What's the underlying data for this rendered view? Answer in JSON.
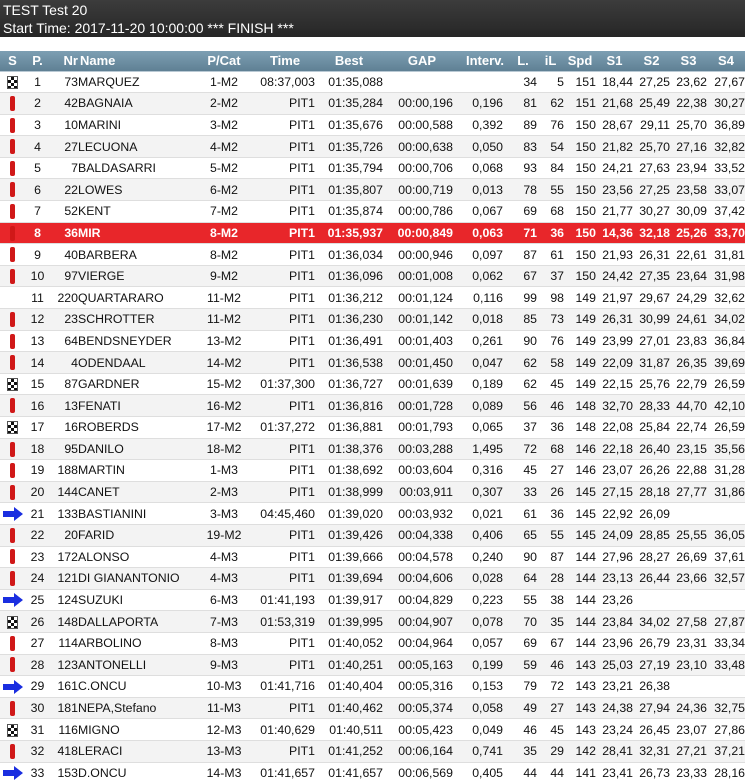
{
  "header": {
    "title": "TEST Test 20",
    "subtitle": "Start Time: 2017-11-20 10:00:00 *** FINISH ***"
  },
  "columns": [
    "S",
    "P.",
    "Nr",
    "Name",
    "P/Cat",
    "Time",
    "Best",
    "GAP",
    "Interv.",
    "L.",
    "iL",
    "Spd",
    "S1",
    "S2",
    "S3",
    "S4"
  ],
  "colors": {
    "title_bg": "#2f2f2f",
    "header_bg": "#6d8fa3",
    "highlight_row": "#e8262a",
    "pit_marker": "#d01818",
    "arrow": "#1a2ee0"
  },
  "rows": [
    {
      "s": "flag-icon",
      "p": "1",
      "nr": "73",
      "name": "MARQUEZ",
      "cat": "1-M2",
      "time": "08:37,003",
      "best": "01:35,088",
      "gap": "",
      "interv": "",
      "l": "34",
      "il": "5",
      "spd": "151",
      "s1": "18,44",
      "s2": "27,25",
      "s3": "23,62",
      "s4": "27,67"
    },
    {
      "s": "pit-icon",
      "p": "2",
      "nr": "42",
      "name": "BAGNAIA",
      "cat": "2-M2",
      "time": "PIT1",
      "best": "01:35,284",
      "gap": "00:00,196",
      "interv": "0,196",
      "l": "81",
      "il": "62",
      "spd": "151",
      "s1": "21,68",
      "s2": "25,49",
      "s3": "22,38",
      "s4": "30,27"
    },
    {
      "s": "pit-icon",
      "p": "3",
      "nr": "10",
      "name": "MARINI",
      "cat": "3-M2",
      "time": "PIT1",
      "best": "01:35,676",
      "gap": "00:00,588",
      "interv": "0,392",
      "l": "89",
      "il": "76",
      "spd": "150",
      "s1": "28,67",
      "s2": "29,11",
      "s3": "25,70",
      "s4": "36,89"
    },
    {
      "s": "pit-icon",
      "p": "4",
      "nr": "27",
      "name": "LECUONA",
      "cat": "4-M2",
      "time": "PIT1",
      "best": "01:35,726",
      "gap": "00:00,638",
      "interv": "0,050",
      "l": "83",
      "il": "54",
      "spd": "150",
      "s1": "21,82",
      "s2": "25,70",
      "s3": "27,16",
      "s4": "32,82"
    },
    {
      "s": "pit-icon",
      "p": "5",
      "nr": "7",
      "name": "BALDASARRI",
      "cat": "5-M2",
      "time": "PIT1",
      "best": "01:35,794",
      "gap": "00:00,706",
      "interv": "0,068",
      "l": "93",
      "il": "84",
      "spd": "150",
      "s1": "24,21",
      "s2": "27,63",
      "s3": "23,94",
      "s4": "33,52"
    },
    {
      "s": "pit-icon",
      "p": "6",
      "nr": "22",
      "name": "LOWES",
      "cat": "6-M2",
      "time": "PIT1",
      "best": "01:35,807",
      "gap": "00:00,719",
      "interv": "0,013",
      "l": "78",
      "il": "55",
      "spd": "150",
      "s1": "23,56",
      "s2": "27,25",
      "s3": "23,58",
      "s4": "33,07"
    },
    {
      "s": "pit-icon",
      "p": "7",
      "nr": "52",
      "name": "KENT",
      "cat": "7-M2",
      "time": "PIT1",
      "best": "01:35,874",
      "gap": "00:00,786",
      "interv": "0,067",
      "l": "69",
      "il": "68",
      "spd": "150",
      "s1": "21,77",
      "s2": "30,27",
      "s3": "30,09",
      "s4": "37,42"
    },
    {
      "s": "pit-icon",
      "p": "8",
      "nr": "36",
      "name": "MIR",
      "cat": "8-M2",
      "time": "PIT1",
      "best": "01:35,937",
      "gap": "00:00,849",
      "interv": "0,063",
      "l": "71",
      "il": "36",
      "spd": "150",
      "s1": "14,36",
      "s2": "32,18",
      "s3": "25,26",
      "s4": "33,70",
      "hl": true
    },
    {
      "s": "pit-icon",
      "p": "9",
      "nr": "40",
      "name": "BARBERA",
      "cat": "8-M2",
      "time": "PIT1",
      "best": "01:36,034",
      "gap": "00:00,946",
      "interv": "0,097",
      "l": "87",
      "il": "61",
      "spd": "150",
      "s1": "21,93",
      "s2": "26,31",
      "s3": "22,61",
      "s4": "31,81"
    },
    {
      "s": "pit-icon",
      "p": "10",
      "nr": "97",
      "name": "VIERGE",
      "cat": "9-M2",
      "time": "PIT1",
      "best": "01:36,096",
      "gap": "00:01,008",
      "interv": "0,062",
      "l": "67",
      "il": "37",
      "spd": "150",
      "s1": "24,42",
      "s2": "27,35",
      "s3": "23,64",
      "s4": "31,98"
    },
    {
      "s": "",
      "p": "11",
      "nr": "220",
      "name": "QUARTARARO",
      "cat": "11-M2",
      "time": "PIT1",
      "best": "01:36,212",
      "gap": "00:01,124",
      "interv": "0,116",
      "l": "99",
      "il": "98",
      "spd": "149",
      "s1": "21,97",
      "s2": "29,67",
      "s3": "24,29",
      "s4": "32,62"
    },
    {
      "s": "pit-icon",
      "p": "12",
      "nr": "23",
      "name": "SCHROTTER",
      "cat": "11-M2",
      "time": "PIT1",
      "best": "01:36,230",
      "gap": "00:01,142",
      "interv": "0,018",
      "l": "85",
      "il": "73",
      "spd": "149",
      "s1": "26,31",
      "s2": "30,99",
      "s3": "24,61",
      "s4": "34,02"
    },
    {
      "s": "pit-icon",
      "p": "13",
      "nr": "64",
      "name": "BENDSNEYDER",
      "cat": "13-M2",
      "time": "PIT1",
      "best": "01:36,491",
      "gap": "00:01,403",
      "interv": "0,261",
      "l": "90",
      "il": "76",
      "spd": "149",
      "s1": "23,99",
      "s2": "27,01",
      "s3": "23,83",
      "s4": "36,84"
    },
    {
      "s": "pit-icon",
      "p": "14",
      "nr": "4",
      "name": "ODENDAAL",
      "cat": "14-M2",
      "time": "PIT1",
      "best": "01:36,538",
      "gap": "00:01,450",
      "interv": "0,047",
      "l": "62",
      "il": "58",
      "spd": "149",
      "s1": "22,09",
      "s2": "31,87",
      "s3": "26,35",
      "s4": "39,69"
    },
    {
      "s": "flag-icon",
      "p": "15",
      "nr": "87",
      "name": "GARDNER",
      "cat": "15-M2",
      "time": "01:37,300",
      "best": "01:36,727",
      "gap": "00:01,639",
      "interv": "0,189",
      "l": "62",
      "il": "45",
      "spd": "149",
      "s1": "22,15",
      "s2": "25,76",
      "s3": "22,79",
      "s4": "26,59"
    },
    {
      "s": "pit-icon",
      "p": "16",
      "nr": "13",
      "name": "FENATI",
      "cat": "16-M2",
      "time": "PIT1",
      "best": "01:36,816",
      "gap": "00:01,728",
      "interv": "0,089",
      "l": "56",
      "il": "46",
      "spd": "148",
      "s1": "32,70",
      "s2": "28,33",
      "s3": "44,70",
      "s4": "42,10"
    },
    {
      "s": "flag-icon",
      "p": "17",
      "nr": "16",
      "name": "ROBERDS",
      "cat": "17-M2",
      "time": "01:37,272",
      "best": "01:36,881",
      "gap": "00:01,793",
      "interv": "0,065",
      "l": "37",
      "il": "36",
      "spd": "148",
      "s1": "22,08",
      "s2": "25,84",
      "s3": "22,74",
      "s4": "26,59"
    },
    {
      "s": "pit-icon",
      "p": "18",
      "nr": "95",
      "name": "DANILO",
      "cat": "18-M2",
      "time": "PIT1",
      "best": "01:38,376",
      "gap": "00:03,288",
      "interv": "1,495",
      "l": "72",
      "il": "68",
      "spd": "146",
      "s1": "22,18",
      "s2": "26,40",
      "s3": "23,15",
      "s4": "35,56"
    },
    {
      "s": "pit-icon",
      "p": "19",
      "nr": "188",
      "name": "MARTIN",
      "cat": "1-M3",
      "time": "PIT1",
      "best": "01:38,692",
      "gap": "00:03,604",
      "interv": "0,316",
      "l": "45",
      "il": "27",
      "spd": "146",
      "s1": "23,07",
      "s2": "26,26",
      "s3": "22,88",
      "s4": "31,28"
    },
    {
      "s": "pit-icon",
      "p": "20",
      "nr": "144",
      "name": "CANET",
      "cat": "2-M3",
      "time": "PIT1",
      "best": "01:38,999",
      "gap": "00:03,911",
      "interv": "0,307",
      "l": "33",
      "il": "26",
      "spd": "145",
      "s1": "27,15",
      "s2": "28,18",
      "s3": "27,77",
      "s4": "31,86"
    },
    {
      "s": "arrow-icon",
      "p": "21",
      "nr": "133",
      "name": "BASTIANINI",
      "cat": "3-M3",
      "time": "04:45,460",
      "best": "01:39,020",
      "gap": "00:03,932",
      "interv": "0,021",
      "l": "61",
      "il": "36",
      "spd": "145",
      "s1": "22,92",
      "s2": "26,09",
      "s3": "",
      "s4": ""
    },
    {
      "s": "pit-icon",
      "p": "22",
      "nr": "20",
      "name": "FARID",
      "cat": "19-M2",
      "time": "PIT1",
      "best": "01:39,426",
      "gap": "00:04,338",
      "interv": "0,406",
      "l": "65",
      "il": "55",
      "spd": "145",
      "s1": "24,09",
      "s2": "28,85",
      "s3": "25,55",
      "s4": "36,05"
    },
    {
      "s": "pit-icon",
      "p": "23",
      "nr": "172",
      "name": "ALONSO",
      "cat": "4-M3",
      "time": "PIT1",
      "best": "01:39,666",
      "gap": "00:04,578",
      "interv": "0,240",
      "l": "90",
      "il": "87",
      "spd": "144",
      "s1": "27,96",
      "s2": "28,27",
      "s3": "26,69",
      "s4": "37,61"
    },
    {
      "s": "pit-icon",
      "p": "24",
      "nr": "121",
      "name": "DI GIANANTONIO",
      "cat": "4-M3",
      "time": "PIT1",
      "best": "01:39,694",
      "gap": "00:04,606",
      "interv": "0,028",
      "l": "64",
      "il": "28",
      "spd": "144",
      "s1": "23,13",
      "s2": "26,44",
      "s3": "23,66",
      "s4": "32,57"
    },
    {
      "s": "arrow-icon",
      "p": "25",
      "nr": "124",
      "name": "SUZUKI",
      "cat": "6-M3",
      "time": "01:41,193",
      "best": "01:39,917",
      "gap": "00:04,829",
      "interv": "0,223",
      "l": "55",
      "il": "38",
      "spd": "144",
      "s1": "23,26",
      "s2": "",
      "s3": "",
      "s4": ""
    },
    {
      "s": "flag-icon",
      "p": "26",
      "nr": "148",
      "name": "DALLAPORTA",
      "cat": "7-M3",
      "time": "01:53,319",
      "best": "01:39,995",
      "gap": "00:04,907",
      "interv": "0,078",
      "l": "70",
      "il": "35",
      "spd": "144",
      "s1": "23,84",
      "s2": "34,02",
      "s3": "27,58",
      "s4": "27,87"
    },
    {
      "s": "pit-icon",
      "p": "27",
      "nr": "114",
      "name": "ARBOLINO",
      "cat": "8-M3",
      "time": "PIT1",
      "best": "01:40,052",
      "gap": "00:04,964",
      "interv": "0,057",
      "l": "69",
      "il": "67",
      "spd": "144",
      "s1": "23,96",
      "s2": "26,79",
      "s3": "23,31",
      "s4": "33,34"
    },
    {
      "s": "pit-icon",
      "p": "28",
      "nr": "123",
      "name": "ANTONELLI",
      "cat": "9-M3",
      "time": "PIT1",
      "best": "01:40,251",
      "gap": "00:05,163",
      "interv": "0,199",
      "l": "59",
      "il": "46",
      "spd": "143",
      "s1": "25,03",
      "s2": "27,19",
      "s3": "23,10",
      "s4": "33,48"
    },
    {
      "s": "arrow-icon",
      "p": "29",
      "nr": "161",
      "name": "C.ONCU",
      "cat": "10-M3",
      "time": "01:41,716",
      "best": "01:40,404",
      "gap": "00:05,316",
      "interv": "0,153",
      "l": "79",
      "il": "72",
      "spd": "143",
      "s1": "23,21",
      "s2": "26,38",
      "s3": "",
      "s4": ""
    },
    {
      "s": "pit-icon",
      "p": "30",
      "nr": "181",
      "name": "NEPA,Stefano",
      "cat": "11-M3",
      "time": "PIT1",
      "best": "01:40,462",
      "gap": "00:05,374",
      "interv": "0,058",
      "l": "49",
      "il": "27",
      "spd": "143",
      "s1": "24,38",
      "s2": "27,94",
      "s3": "24,36",
      "s4": "32,75"
    },
    {
      "s": "flag-icon",
      "p": "31",
      "nr": "116",
      "name": "MIGNO",
      "cat": "12-M3",
      "time": "01:40,629",
      "best": "01:40,511",
      "gap": "00:05,423",
      "interv": "0,049",
      "l": "46",
      "il": "45",
      "spd": "143",
      "s1": "23,24",
      "s2": "26,45",
      "s3": "23,07",
      "s4": "27,86"
    },
    {
      "s": "pit-icon",
      "p": "32",
      "nr": "418",
      "name": "LERACI",
      "cat": "13-M3",
      "time": "PIT1",
      "best": "01:41,252",
      "gap": "00:06,164",
      "interv": "0,741",
      "l": "35",
      "il": "29",
      "spd": "142",
      "s1": "28,41",
      "s2": "32,31",
      "s3": "27,21",
      "s4": "37,21"
    },
    {
      "s": "arrow-icon",
      "p": "33",
      "nr": "153",
      "name": "D.ONCU",
      "cat": "14-M3",
      "time": "01:41,657",
      "best": "01:41,657",
      "gap": "00:06,569",
      "interv": "0,405",
      "l": "44",
      "il": "44",
      "spd": "141",
      "s1": "23,41",
      "s2": "26,73",
      "s3": "23,33",
      "s4": "28,16"
    }
  ]
}
